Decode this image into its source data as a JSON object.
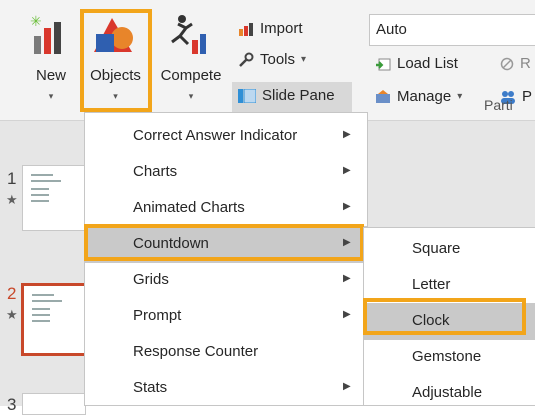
{
  "ribbon": {
    "new_label": "New",
    "objects_label": "Objects",
    "compete_label": "Compete",
    "import_label": "Import",
    "tools_label": "Tools",
    "slide_pane_label": "Slide Pane",
    "auto_value": "Auto",
    "load_list_label": "Load List",
    "second_r_label": "R",
    "manage_label": "Manage",
    "participants_partial": "P",
    "group_label": "Parti",
    "dropdown_arrow": "▾"
  },
  "slides": [
    {
      "number": "1",
      "star": "★"
    },
    {
      "number": "2",
      "star": "★"
    },
    {
      "number": "3"
    }
  ],
  "menu": {
    "items": [
      {
        "label": "Correct Answer Indicator",
        "submenu": true
      },
      {
        "label": "Charts",
        "submenu": true
      },
      {
        "label": "Animated Charts",
        "submenu": true
      },
      {
        "label": "Countdown",
        "submenu": true,
        "highlighted": true
      },
      {
        "label": "Grids",
        "submenu": true
      },
      {
        "label": "Prompt",
        "submenu": true
      },
      {
        "label": "Response Counter",
        "submenu": false
      },
      {
        "label": "Stats",
        "submenu": true
      }
    ],
    "submenu_arrow": "▶"
  },
  "submenu": {
    "items": [
      {
        "label": "Square"
      },
      {
        "label": "Letter"
      },
      {
        "label": "Clock",
        "highlighted": true
      },
      {
        "label": "Gemstone"
      },
      {
        "label": "Adjustable"
      }
    ]
  },
  "colors": {
    "highlight_outline": "#f2a51a",
    "menu_highlight": "#c9c9c9",
    "selected_slide_border": "#c8482a",
    "selected_slide_number": "#c8482a"
  }
}
